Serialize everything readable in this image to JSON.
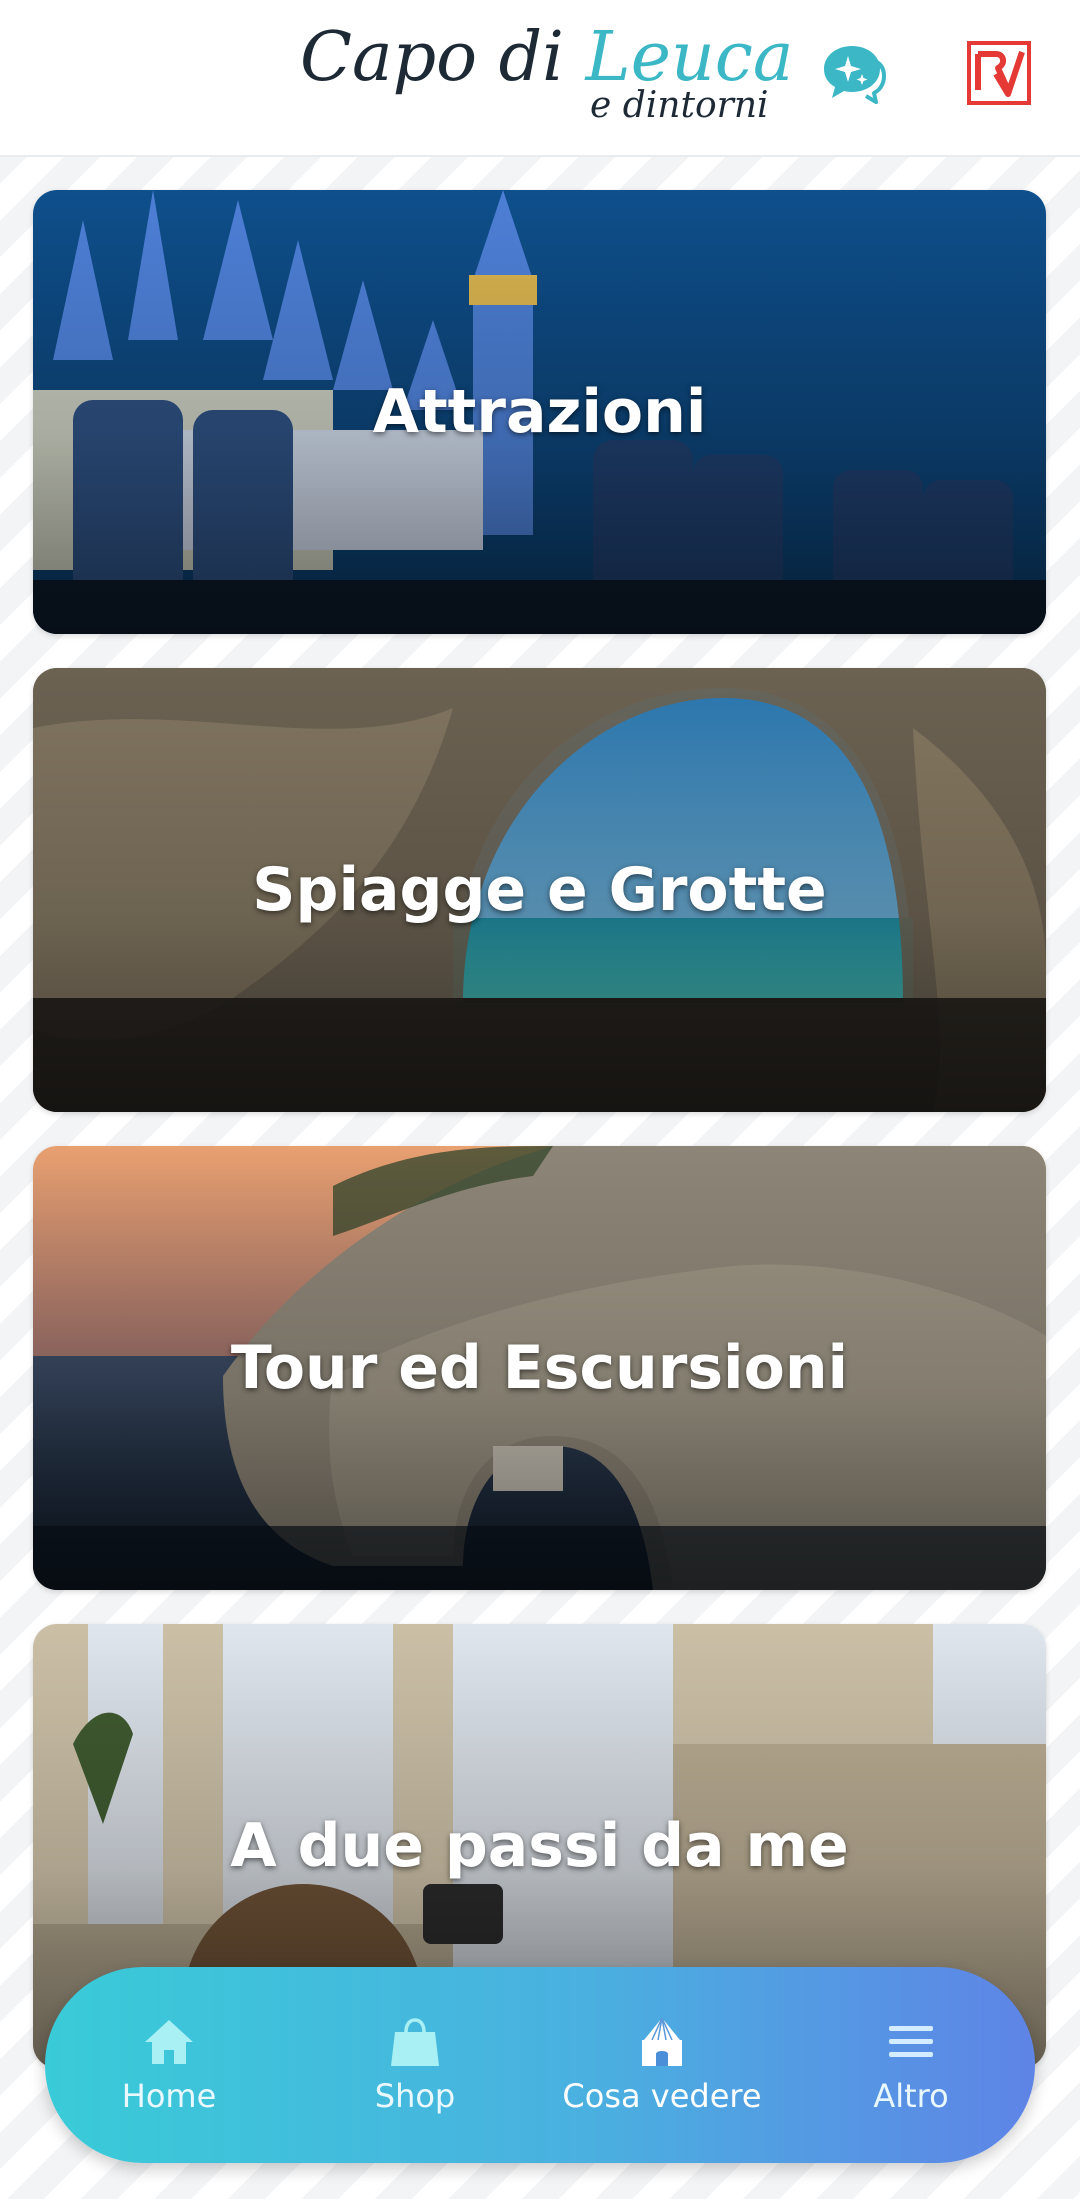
{
  "header": {
    "logo_part1": "Capo di ",
    "logo_part2": "Leuca",
    "logo_sub": "e dintorni",
    "chat_icon": "chat-sparkle-icon",
    "brand_icon": "rv-logo-icon"
  },
  "cards": [
    {
      "title": "Attrazioni"
    },
    {
      "title": "Spiagge e Grotte"
    },
    {
      "title": "Tour ed Escursioni"
    },
    {
      "title": "A due passi da me"
    }
  ],
  "nav": {
    "items": [
      {
        "label": "Home",
        "icon": "home-icon"
      },
      {
        "label": "Shop",
        "icon": "shopping-bag-icon"
      },
      {
        "label": "Cosa vedere",
        "icon": "trullo-icon"
      },
      {
        "label": "Altro",
        "icon": "menu-icon"
      }
    ],
    "active": "Cosa vedere"
  },
  "colors": {
    "accent": "#3bb7c6",
    "nav_gradient_start": "#39cbd8",
    "nav_gradient_end": "#5e84e6",
    "brand_red": "#e53935"
  }
}
